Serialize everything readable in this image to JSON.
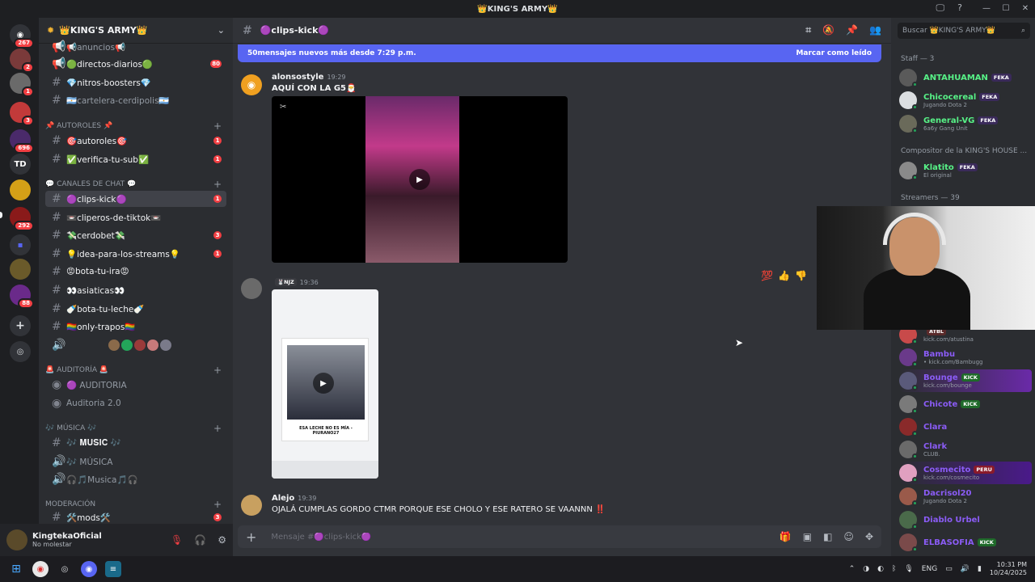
{
  "window": {
    "title": "👑KING'S ARMY👑"
  },
  "rail": {
    "badges": [
      "267",
      "2",
      "1",
      "3",
      "696",
      "292",
      "88"
    ],
    "td_label": "TD"
  },
  "guild": {
    "name": "👑KING'S ARMY👑"
  },
  "channels": [
    {
      "name": "📢anuncios📢",
      "count": ""
    },
    {
      "name": "🟢directos-diarios🟢",
      "count": "80"
    },
    {
      "name": "💎nitros-boosters💎",
      "count": ""
    },
    {
      "name": "🇦🇷cartelera-cerdipolis🇦🇷",
      "count": ""
    }
  ],
  "cat_autoroles": "📌 AUTOROLES 📌",
  "autoroles_channels": [
    {
      "name": "🎯autoroles🎯",
      "count": "1"
    },
    {
      "name": "✅verifica-tu-sub✅",
      "count": "1"
    }
  ],
  "cat_canales": "💬 CANALES DE CHAT 💬",
  "chat_channels": [
    {
      "name": "🟣clips-kick🟣",
      "count": "1"
    },
    {
      "name": "📼cliperos-de-tiktok📼",
      "count": ""
    },
    {
      "name": "💸cerdobet💸",
      "count": "3"
    },
    {
      "name": "💡idea-para-los-streams💡",
      "count": "1"
    },
    {
      "name": "😡bota-tu-ira😡",
      "count": ""
    },
    {
      "name": "👀asiaticas👀",
      "count": ""
    },
    {
      "name": "🍼bota-tu-leche🍼",
      "count": ""
    },
    {
      "name": "🏳️‍🌈only-trapos🏳️‍🌈",
      "count": ""
    }
  ],
  "cat_auditoria": "🚨 AUDITORÍA 🚨",
  "auditoria_channels": [
    {
      "name": "🟣 AUDITORIA"
    },
    {
      "name": "Auditoria 2.0"
    }
  ],
  "cat_musica": "🎶 MÚSICA 🎶",
  "musica_channels": [
    {
      "name": "🎶 𝐌𝐔𝐒𝐈𝐂 🎶"
    },
    {
      "name": "🎶 MÚSICA"
    },
    {
      "name": "🎧🎵Musica🎵🎧"
    }
  ],
  "cat_moderacion": "MODERACIÓN",
  "mod_channel": {
    "name": "🛠️mods🛠️",
    "count": "3"
  },
  "user": {
    "name": "KingtekaOficial",
    "status": "No molestar"
  },
  "chat": {
    "channel": "🟣clips-kick🟣",
    "newbar_text": "50mensajes nuevos más desde 7:29 p.m.",
    "newbar_action": "Marcar como leído",
    "messages": [
      {
        "author": "alonsostyle",
        "time": "19:29",
        "text": "AQUÍ CON LA G5🎅"
      },
      {
        "author": "",
        "tag": "🐰NJZ",
        "time": "19:36",
        "text": "",
        "card_caption": "ESA LECHE NO ES MÍA - PIURANO27"
      },
      {
        "author": "Alejo",
        "time": "19:39",
        "text": "OJALÁ CUMPLAS GORDO CTMR PORQUE ESE CHOLO Y ESE RATERO SE VAANNN ‼️"
      }
    ],
    "composer_placeholder": "Mensaje #🟣clips-kick🟣"
  },
  "members": {
    "search_placeholder": "Buscar 👑KING'S ARMY👑",
    "group_staff": "Staff — 3",
    "staff": [
      {
        "name": "ANTAHUAMAN",
        "tag": "FEKA",
        "sub": "",
        "color": "#57f287"
      },
      {
        "name": "Chicocereal",
        "tag": "FEKA",
        "sub": "Jugando Dota 2",
        "color": "#57f287"
      },
      {
        "name": "General-VG",
        "tag": "FEKA",
        "sub": "6a6y Gang Unit",
        "color": "#57f287"
      }
    ],
    "group_compositor": "Compositor de la KING'S HOUSE ...",
    "compositor": [
      {
        "name": "Klatito",
        "tag": "FEKA",
        "sub": "El original",
        "color": "#57f287"
      }
    ],
    "group_streamers": "Streamers — 39",
    "streamers": [
      {
        "name": "",
        "tag": "ATBL",
        "sub": "kick.com/atustina",
        "color": "#8b5cf6"
      },
      {
        "name": "Bambu",
        "tag": "",
        "sub": "• kick.com/Bambugg",
        "color": "#8b5cf6"
      },
      {
        "name": "Bounge",
        "tag": "KICK",
        "sub": "kick.com/bounge",
        "color": "#8b5cf6"
      },
      {
        "name": "Chicote",
        "tag": "KICK",
        "sub": "",
        "color": "#8b5cf6"
      },
      {
        "name": "Clara",
        "tag": "",
        "sub": "",
        "color": "#8b5cf6"
      },
      {
        "name": "Clark",
        "tag": "",
        "sub": "CLUB.",
        "color": "#8b5cf6"
      },
      {
        "name": "Cosmecito",
        "tag": "PERU",
        "sub": "kick.com/cosmecito",
        "color": "#8b5cf6"
      },
      {
        "name": "Dacrisol20",
        "tag": "",
        "sub": "Jugando Dota 2",
        "color": "#8b5cf6"
      },
      {
        "name": "Diablo Urbel",
        "tag": "",
        "sub": "",
        "color": "#8b5cf6"
      },
      {
        "name": "ELBASOFIA",
        "tag": "KICK",
        "sub": "",
        "color": "#8b5cf6"
      }
    ]
  },
  "taskbar": {
    "lang": "ENG",
    "time": "10:31 PM",
    "date": "10/24/2025"
  },
  "colors": {
    "accent": "#5865f2",
    "unread_badge": "#f23f43",
    "online": "#23a55a"
  }
}
